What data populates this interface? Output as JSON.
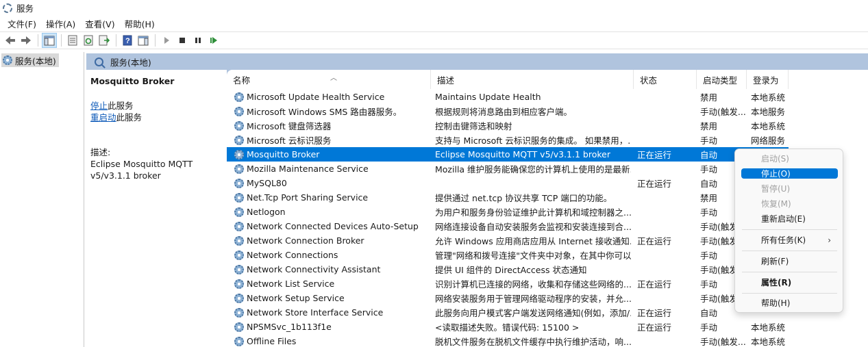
{
  "window": {
    "title": "服务"
  },
  "menu": [
    "文件(F)",
    "操作(A)",
    "查看(V)",
    "帮助(H)"
  ],
  "toolbar": [
    "back-icon",
    "forward-icon",
    "console-tree-icon",
    "properties-icon",
    "refresh-icon",
    "export-icon",
    "help-icon",
    "action-pane-icon",
    "start-service-icon",
    "stop-service-icon",
    "pause-service-icon",
    "restart-service-icon"
  ],
  "tree": {
    "root_label": "服务(本地)"
  },
  "pane_header": "服务(本地)",
  "detail": {
    "title": "Mosquitto Broker",
    "stop_link": "停止",
    "stop_suffix": "此服务",
    "restart_link": "重启动",
    "restart_suffix": "此服务",
    "desc_label": "描述:",
    "desc_text": "Eclipse Mosquitto MQTT v5/v3.1.1 broker"
  },
  "columns": {
    "name": "名称",
    "desc": "描述",
    "status": "状态",
    "startup": "启动类型",
    "logon": "登录为"
  },
  "services": [
    {
      "name": "Microsoft Update Health Service",
      "desc": "Maintains Update Health",
      "status": "",
      "startup": "禁用",
      "logon": "本地系统"
    },
    {
      "name": "Microsoft Windows SMS 路由器服务。",
      "desc": "根据规则将消息路由到相应客户端。",
      "status": "",
      "startup": "手动(触发...",
      "logon": "本地服务"
    },
    {
      "name": "Microsoft 键盘筛选器",
      "desc": "控制击键筛选和映射",
      "status": "",
      "startup": "禁用",
      "logon": "本地系统"
    },
    {
      "name": "Microsoft 云标识服务",
      "desc": "支持与 Microsoft 云标识服务的集成。 如果禁用，...",
      "status": "",
      "startup": "手动",
      "logon": "网络服务"
    },
    {
      "name": "Mosquitto Broker",
      "desc": "Eclipse Mosquitto MQTT v5/v3.1.1 broker",
      "status": "正在运行",
      "startup": "自动",
      "logon": "",
      "selected": true
    },
    {
      "name": "Mozilla Maintenance Service",
      "desc": "Mozilla 维护服务能确保您的计算机上使用的是最新...",
      "status": "",
      "startup": "手动",
      "logon": ""
    },
    {
      "name": "MySQL80",
      "desc": "",
      "status": "正在运行",
      "startup": "自动",
      "logon": ""
    },
    {
      "name": "Net.Tcp Port Sharing Service",
      "desc": "提供通过 net.tcp 协议共享 TCP 端口的功能。",
      "status": "",
      "startup": "禁用",
      "logon": ""
    },
    {
      "name": "Netlogon",
      "desc": "为用户和服务身份验证维护此计算机和域控制器之...",
      "status": "",
      "startup": "手动",
      "logon": ""
    },
    {
      "name": "Network Connected Devices Auto-Setup",
      "desc": "网络连接设备自动安装服务会监视和安装连接到合...",
      "status": "",
      "startup": "手动(触发",
      "logon": ""
    },
    {
      "name": "Network Connection Broker",
      "desc": "允许 Windows 应用商店应用从 Internet 接收通知...",
      "status": "正在运行",
      "startup": "手动(触发",
      "logon": ""
    },
    {
      "name": "Network Connections",
      "desc": "管理\"网络和拨号连接\"文件夹中对象，在其中你可以...",
      "status": "",
      "startup": "手动",
      "logon": ""
    },
    {
      "name": "Network Connectivity Assistant",
      "desc": "提供 UI 组件的 DirectAccess 状态通知",
      "status": "",
      "startup": "手动(触发",
      "logon": ""
    },
    {
      "name": "Network List Service",
      "desc": "识别计算机已连接的网络，收集和存储这些网络的...",
      "status": "正在运行",
      "startup": "手动",
      "logon": ""
    },
    {
      "name": "Network Setup Service",
      "desc": "网络安装服务用于管理网络驱动程序的安装，并允...",
      "status": "",
      "startup": "手动(触发",
      "logon": ""
    },
    {
      "name": "Network Store Interface Service",
      "desc": "此服务向用户模式客户端发送网络通知(例如，添加/...",
      "status": "正在运行",
      "startup": "自动",
      "logon": ""
    },
    {
      "name": "NPSMSvc_1b113f1e",
      "desc": "<读取描述失败。错误代码: 15100 >",
      "status": "正在运行",
      "startup": "手动",
      "logon": "本地系统"
    },
    {
      "name": "Offline Files",
      "desc": "脱机文件服务在脱机文件缓存中执行维护活动，响...",
      "status": "",
      "startup": "手动(触发...",
      "logon": "本地系统"
    }
  ],
  "context_menu": {
    "start": "启动(S)",
    "stop": "停止(O)",
    "pause": "暂停(U)",
    "resume": "恢复(M)",
    "restart": "重新启动(E)",
    "all_tasks": "所有任务(K)",
    "refresh": "刷新(F)",
    "properties": "属性(R)",
    "help": "帮助(H)"
  },
  "colors": {
    "selection": "#0078d7",
    "pane_header_bg": "#b0c4de",
    "link": "#0b58b8"
  }
}
